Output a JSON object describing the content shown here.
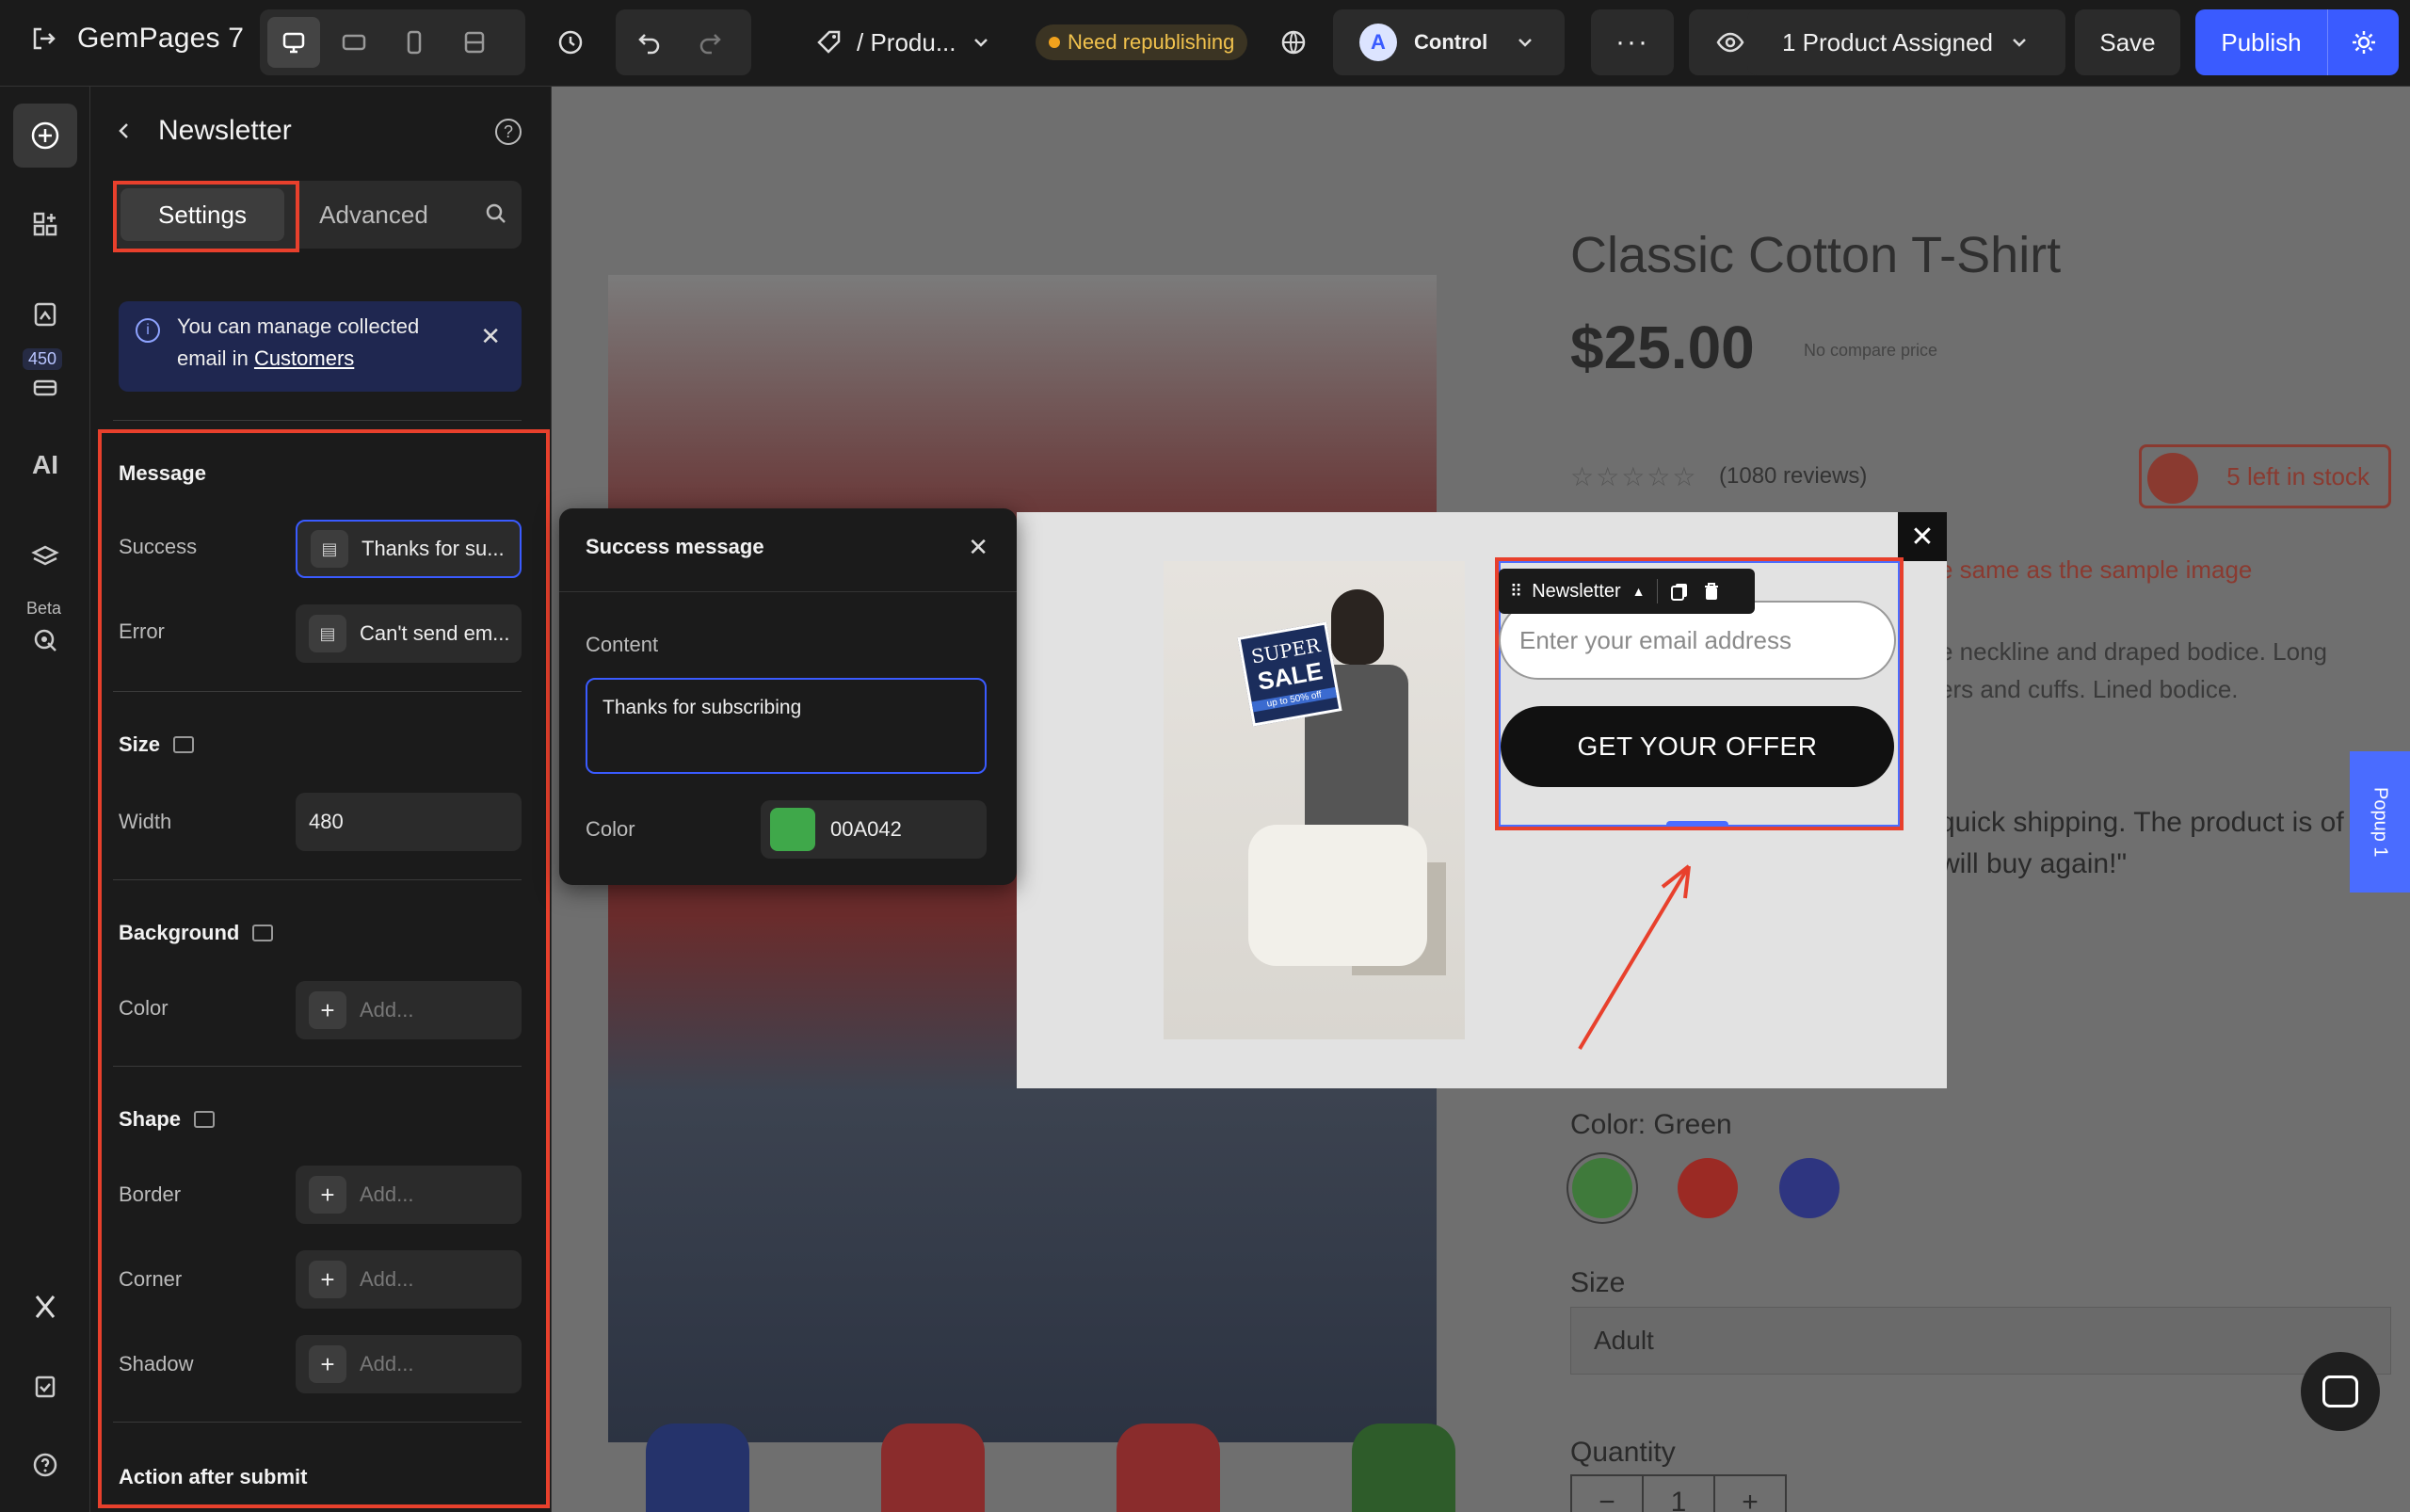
{
  "app": {
    "name": "GemPages 7"
  },
  "toolbar": {
    "page_label": "/ Produ...",
    "status": "Need republishing",
    "variant": "Control",
    "variant_avatar": "A",
    "product_assigned": "1 Product Assigned",
    "save_label": "Save",
    "publish_label": "Publish"
  },
  "rail": {
    "badge_count": "450",
    "beta_label": "Beta",
    "ai_label": "AI"
  },
  "panel": {
    "title": "Newsletter",
    "tabs": [
      "Settings",
      "Advanced"
    ],
    "info_text": "You can manage collected email in",
    "info_link": "Customers",
    "message": {
      "title": "Message",
      "success_label": "Success",
      "success_value": "Thanks for su...",
      "error_label": "Error",
      "error_value": "Can't send em..."
    },
    "size": {
      "title": "Size",
      "width_label": "Width",
      "width_value": "480"
    },
    "background": {
      "title": "Background",
      "color_label": "Color",
      "color_placeholder": "Add..."
    },
    "shape": {
      "title": "Shape",
      "border_label": "Border",
      "corner_label": "Corner",
      "shadow_label": "Shadow",
      "placeholder": "Add..."
    },
    "action_title": "Action after submit"
  },
  "success_popover": {
    "title": "Success message",
    "content_label": "Content",
    "content_value": "Thanks for subscribing",
    "color_label": "Color",
    "color_value": "00A042"
  },
  "product": {
    "title": "Classic Cotton T-Shirt",
    "price": "$25.00",
    "compare": "No compare price",
    "reviews": "(1080 reviews)",
    "stock": "5 left in stock",
    "note": "e same as the sample image",
    "desc_line1": "e neckline and draped bodice. Long",
    "desc_line2": "ers and cuffs. Lined bodice.",
    "quote_line1": "quick shipping. The product is of",
    "quote_line2": "will buy again!\"",
    "color_label": "Color: Green",
    "size_label": "Size",
    "size_value": "Adult",
    "qty_label": "Quantity",
    "qty_value": "1",
    "popup_tab": "Popup 1"
  },
  "popup": {
    "sale_line1": "SUPER",
    "sale_line2": "SALE",
    "sale_line3": "up to 50% off",
    "toolbar_label": "Newsletter",
    "email_placeholder": "Enter your email address",
    "cta": "GET YOUR OFFER"
  },
  "colors": {
    "accent": "#3a5bff",
    "highlight": "#e8402c",
    "success_green": "#00A042",
    "swatches": [
      "#3f7a3b",
      "#9b2a24",
      "#2e3580"
    ]
  }
}
